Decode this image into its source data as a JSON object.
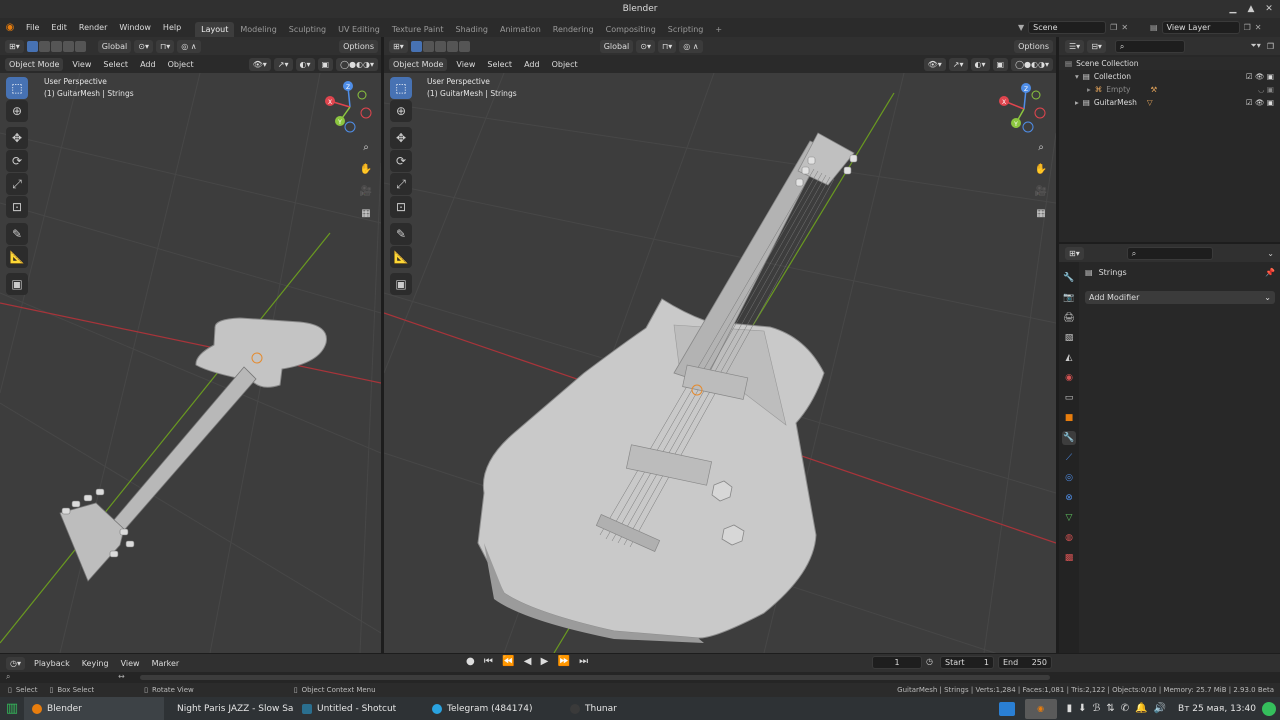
{
  "window": {
    "title": "Blender"
  },
  "menubar": [
    "File",
    "Edit",
    "Render",
    "Window",
    "Help"
  ],
  "workspaces": [
    "Layout",
    "Modeling",
    "Sculpting",
    "UV Editing",
    "Texture Paint",
    "Shading",
    "Animation",
    "Rendering",
    "Compositing",
    "Scripting"
  ],
  "active_workspace": "Layout",
  "scene": "Scene",
  "view_layer": "View Layer",
  "viewports": [
    {
      "mode": "Object Mode",
      "menus": [
        "View",
        "Select",
        "Add",
        "Object"
      ],
      "orientation": "Global",
      "options": "Options",
      "info_line1": "User Perspective",
      "info_line2": "(1) GuitarMesh | Strings"
    },
    {
      "mode": "Object Mode",
      "menus": [
        "View",
        "Select",
        "Add",
        "Object"
      ],
      "orientation": "Global",
      "options": "Options",
      "info_line1": "User Perspective",
      "info_line2": "(1) GuitarMesh | Strings"
    }
  ],
  "gizmo": {
    "x": "X",
    "y": "Y",
    "z": "Z",
    "colors": {
      "x": "#e0454e",
      "y": "#8cc63f",
      "z": "#4f8ee8"
    }
  },
  "outliner": {
    "rows": [
      {
        "label": "Scene Collection",
        "indent": 0
      },
      {
        "label": "Collection",
        "indent": 1
      },
      {
        "label": "Empty",
        "indent": 2
      },
      {
        "label": "GuitarMesh",
        "indent": 1
      }
    ]
  },
  "properties": {
    "object_name": "Strings",
    "add_modifier": "Add Modifier"
  },
  "timeline": {
    "menus": [
      "Playback",
      "Keying",
      "View",
      "Marker"
    ],
    "current_frame": "1",
    "start_label": "Start",
    "start": "1",
    "end_label": "End",
    "end": "250"
  },
  "statusbar": {
    "hint_select": "Select",
    "hint_box": "Box Select",
    "hint_rotate": "Rotate View",
    "hint_context": "Object Context Menu",
    "stats": "GuitarMesh | Strings | Verts:1,284 | Faces:1,081 | Tris:2,122 | Objects:0/10 | Memory: 25.7 MiB | 2.93.0 Beta"
  },
  "taskbar": {
    "tasks": [
      "Blender",
      "Night Paris JAZZ - Slow Sax...",
      "Untitled - Shotcut",
      "Telegram (484174)",
      "Thunar"
    ],
    "clock": "Вт 25 мая, 13:40"
  },
  "colors": {
    "accent": "#4772b3",
    "viewport_bg": "#3d3d3d",
    "x_axis": "#c0393f",
    "y_axis": "#6d9c1f"
  }
}
